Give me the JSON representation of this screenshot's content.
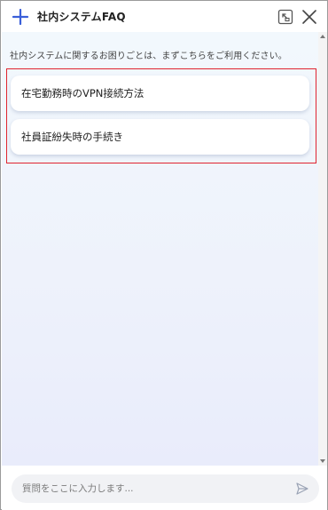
{
  "header": {
    "title": "社内システムFAQ",
    "icons": {
      "brand": "plus-icon",
      "shrink": "shrink-window-icon",
      "close": "close-icon"
    }
  },
  "intro": {
    "text": "社内システムに関するお困りごとは、まずこちらをご利用ください。"
  },
  "options": [
    {
      "label": "在宅勤務時のVPN接続方法"
    },
    {
      "label": "社員証紛失時の手続き"
    }
  ],
  "footer": {
    "placeholder": "質問をここに入力します...",
    "send_icon": "send-icon"
  },
  "colors": {
    "accent": "#3a5fd9",
    "highlight_border": "#e0242f",
    "gradient_top": "#f2f8fd",
    "gradient_bottom": "#e9ecfb"
  }
}
